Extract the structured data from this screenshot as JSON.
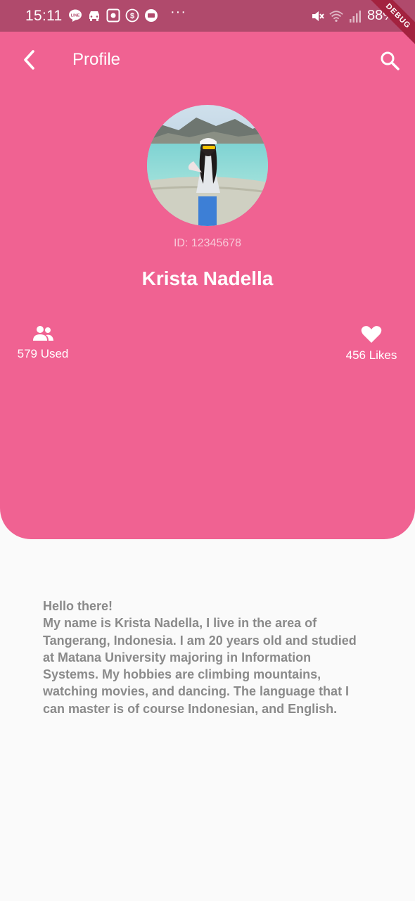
{
  "status_bar": {
    "time": "15:11",
    "dots": "···",
    "battery": "88%",
    "debug_banner": "DEBUG",
    "icons": [
      "line-icon",
      "car-icon",
      "app-icon",
      "currency-icon",
      "message-icon",
      "mute-icon",
      "wifi-icon",
      "signal-icon"
    ]
  },
  "app_bar": {
    "title": "Profile",
    "back_icon": "chevron-left-icon",
    "search_icon": "search-icon"
  },
  "profile": {
    "user_id": "ID: 12345678",
    "name": "Krista Nadella"
  },
  "stats": {
    "used": {
      "label": "579 Used",
      "icon": "people-icon"
    },
    "likes": {
      "label": "456 Likes",
      "icon": "heart-icon"
    }
  },
  "bio": {
    "greeting": "Hello there!",
    "body": "My name is Krista Nadella, I live in the area of Tangerang, Indonesia. I am 20 years old and studied at Matana University majoring in Information Systems. My hobbies are climbing mountains, watching movies, and dancing. The language that I can master is of course Indonesian, and English."
  },
  "colors": {
    "header": "#f06292",
    "status_bar": "#b04a6c",
    "background": "#fafafa",
    "bio_text": "#8a8a8a"
  }
}
